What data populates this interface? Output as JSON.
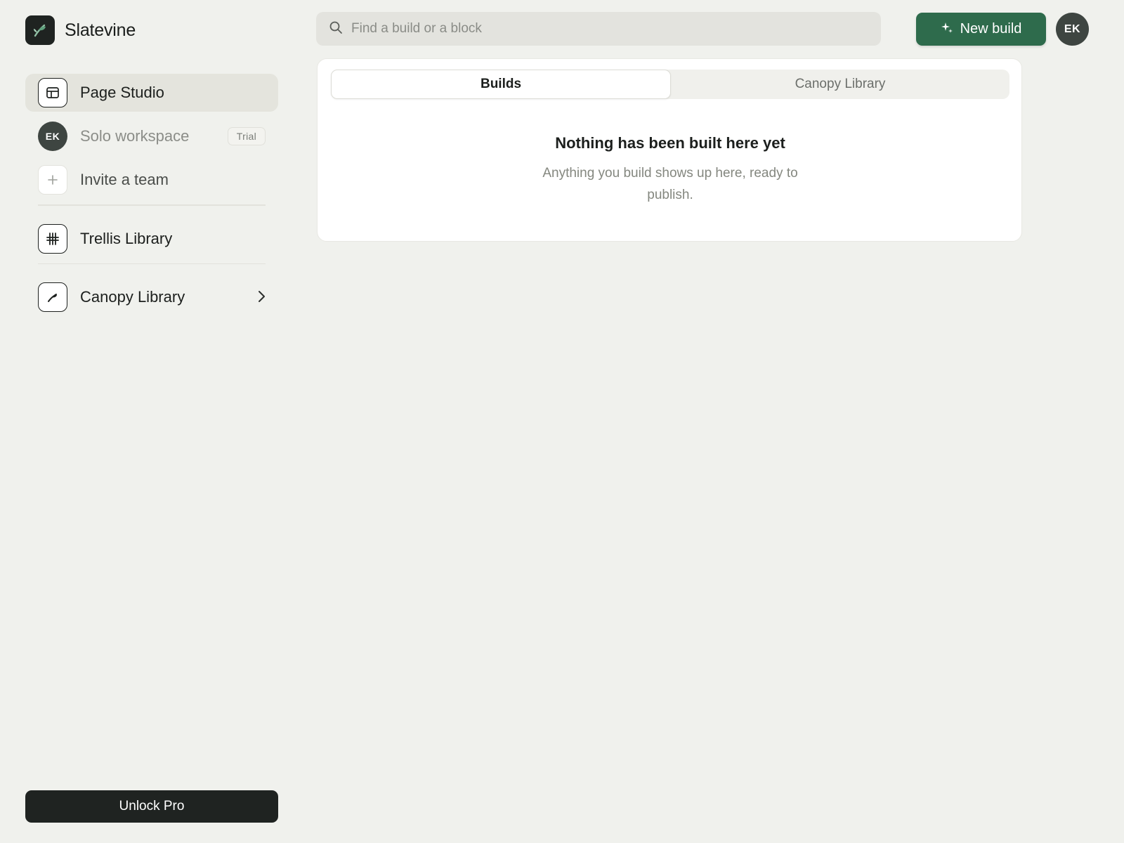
{
  "app": {
    "name": "Slatevine",
    "logo_icon": "sprout-icon"
  },
  "sidebar": {
    "items": [
      {
        "label": "Page Studio",
        "icon": "layout-icon",
        "active": true
      },
      {
        "label": "Solo workspace",
        "avatar_initials": "EK",
        "badge": "Trial"
      },
      {
        "label": "Invite a team",
        "icon": "plus-icon"
      },
      {
        "label": "Trellis Library",
        "icon": "grid-hash-icon"
      },
      {
        "label": "Canopy Library",
        "icon": "sprout-icon",
        "trailing_icon": "chevron-right-icon"
      }
    ],
    "unlock_label": "Unlock Pro"
  },
  "topbar": {
    "search": {
      "placeholder": "Find a build or a block",
      "value": ""
    },
    "new_build_label": "New build",
    "user_initials": "EK"
  },
  "main": {
    "tabs": [
      {
        "label": "Builds",
        "active": true
      },
      {
        "label": "Canopy Library",
        "active": false
      }
    ],
    "empty_state": {
      "title": "Nothing has been built here yet",
      "subtitle": "Anything you build shows up here, ready to publish."
    }
  },
  "colors": {
    "background": "#f0f1ed",
    "accent_green": "#2e6b4c",
    "dark": "#1f2321",
    "avatar": "#3e4541"
  }
}
